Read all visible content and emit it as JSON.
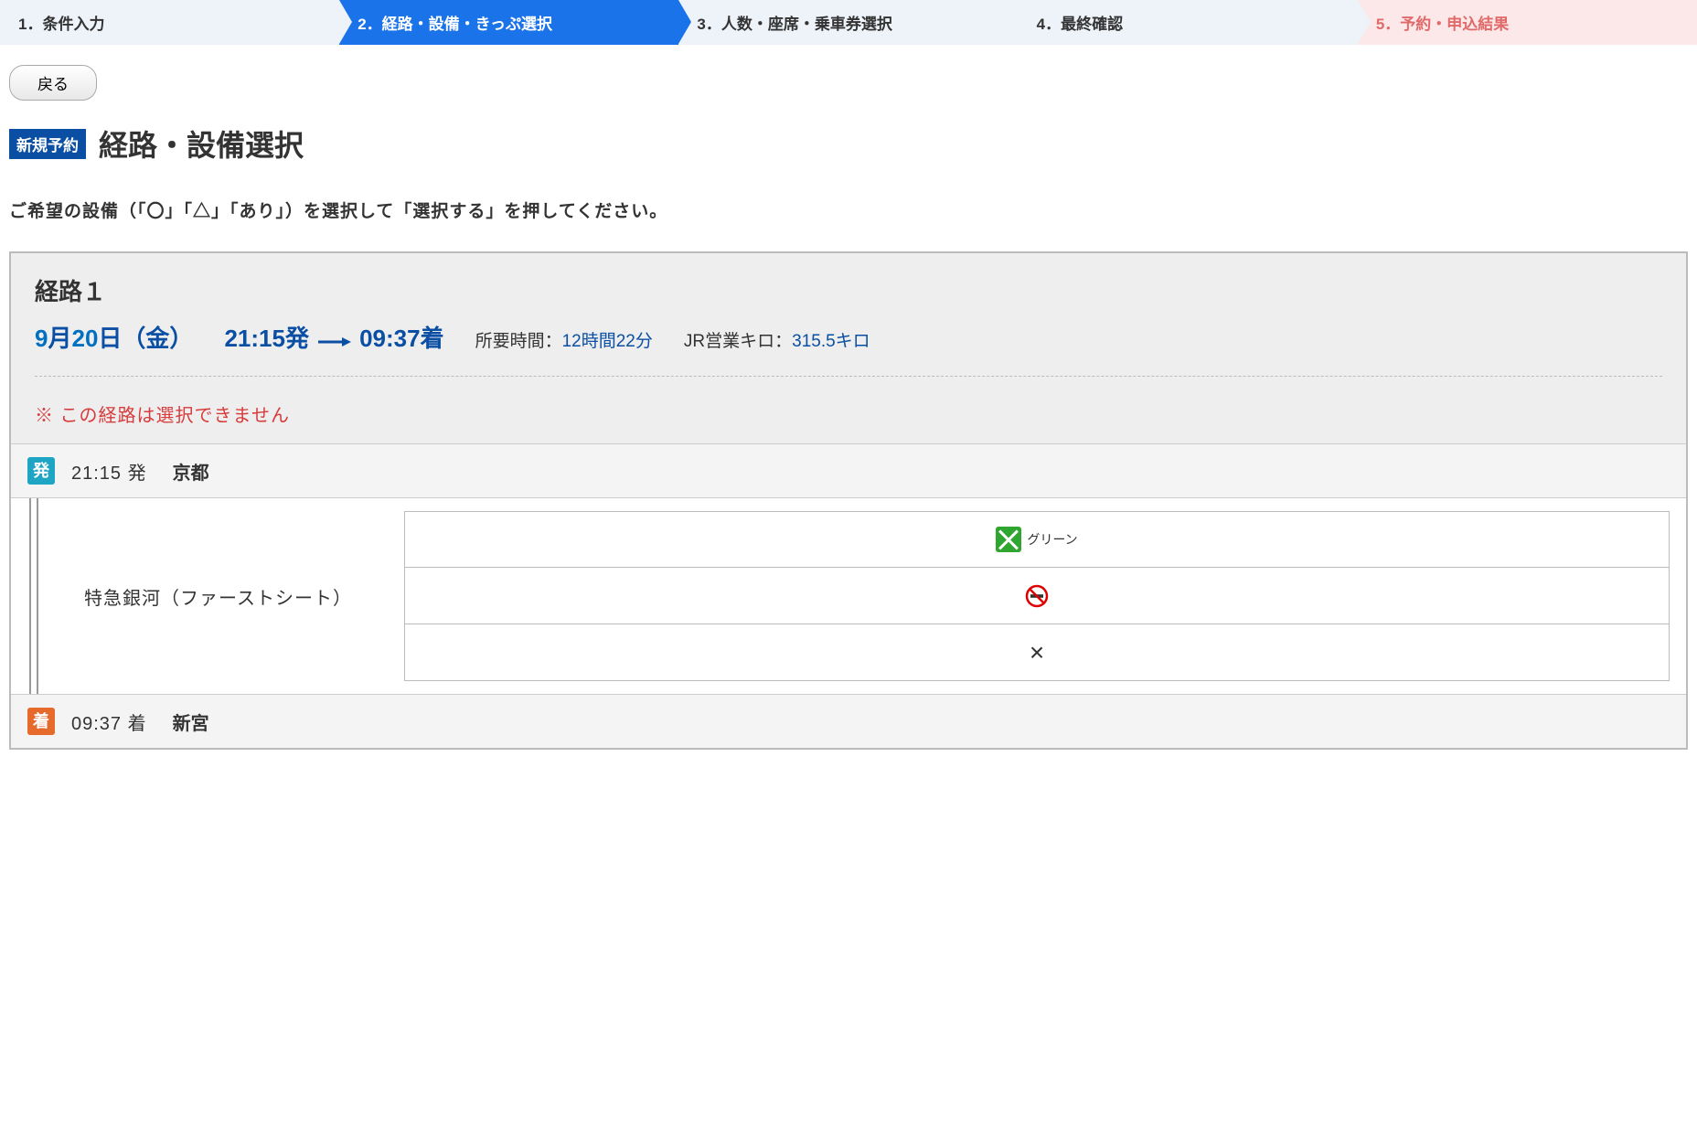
{
  "steps": {
    "s1": "1．条件入力",
    "s2": "2．経路・設備・きっぷ選択",
    "s3": "3．人数・座席・乗車券選択",
    "s4": "4．最終確認",
    "s5": "5．予約・申込結果"
  },
  "back_label": "戻る",
  "badge_new": "新規予約",
  "page_title": "経路・設備選択",
  "instruction": "ご希望の設備（「〇」「△」「あり」）を選択して「選択する」を押してください。",
  "route": {
    "title": "経路１",
    "month": "9",
    "month_unit": "月",
    "day": "20",
    "day_unit": "日",
    "weekday": "（金）",
    "dep_time": "21:15",
    "dep_suffix": "発",
    "arr_time": "09:37",
    "arr_suffix": "着",
    "duration_label": "所要時間：",
    "duration_value": "12時間22分",
    "distance_label": "JR営業キロ：",
    "distance_value": "315.5キロ",
    "warning": "※ この経路は選択できません"
  },
  "dep": {
    "badge": "発",
    "time": "21:15 発",
    "station": "京都"
  },
  "arr": {
    "badge": "着",
    "time": "09:37 着",
    "station": "新宮"
  },
  "segment": {
    "train_name": "特急銀河（ファーストシート）",
    "green_label": "グリーン",
    "x_label": "×"
  }
}
